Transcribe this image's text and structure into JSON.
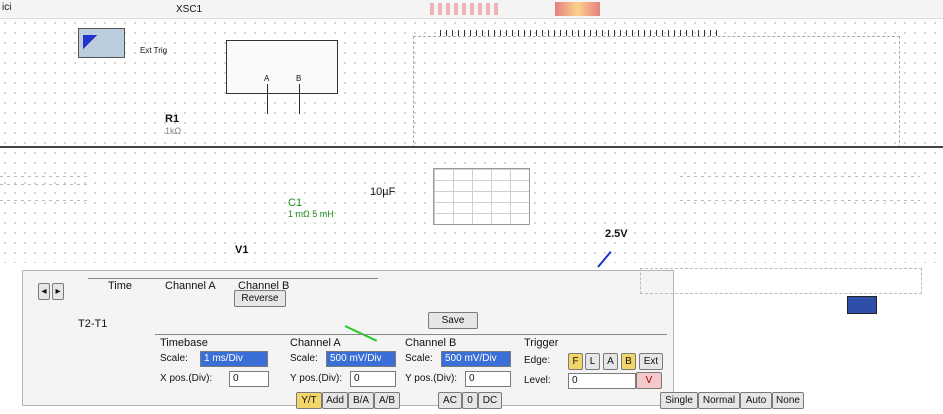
{
  "top_strip": {
    "left_label": "ici",
    "tab_a": "XSC1"
  },
  "schematic": {
    "ext_trig_label": "Ext Trig",
    "probe_a": "A",
    "probe_b": "B",
    "resistor": {
      "name": "R1",
      "value": "1kΩ"
    },
    "capacitor": {
      "name": "C1",
      "value": "10µF"
    },
    "c1_sub": "C1",
    "c1_sub2": "1 mΩ 5 mH",
    "source": {
      "name": "V1",
      "value": "2.5V"
    }
  },
  "scope_window": {
    "columns": {
      "time": "Time",
      "channel_a": "Channel A",
      "channel_b": "Channel B"
    },
    "t2_label": "T2-T1",
    "reverse_button": "Reverse",
    "save_button": "Save",
    "timebase": {
      "title": "Timebase",
      "scale_label": "Scale:",
      "scale_value": "1 ms/Div",
      "xpos_label": "X pos.(Div):",
      "xpos_value": "0"
    },
    "channel_a": {
      "title": "Channel A",
      "scale_label": "Scale:",
      "scale_value": "500 mV/Div",
      "ypos_label": "Y pos.(Div):",
      "ypos_value": "0"
    },
    "channel_b": {
      "title": "Channel B",
      "scale_label": "Scale:",
      "scale_value": "500 mV/Div",
      "ypos_label": "Y pos.(Div):",
      "ypos_value": "0"
    },
    "trigger": {
      "title": "Trigger",
      "edge_label": "Edge:",
      "level_label": "Level:",
      "level_value": "0",
      "level_unit": "V",
      "edge_buttons": [
        "F",
        "L",
        "A",
        "B",
        "Ext"
      ]
    },
    "bottom_buttons_a": [
      "Y/T",
      "Add",
      "B/A",
      "A/B"
    ],
    "bottom_buttons_b": [
      "AC",
      "0",
      "DC"
    ],
    "mode_buttons": [
      "Single",
      "Normal",
      "Auto",
      "None"
    ]
  },
  "colors": {
    "accent": "#3a6fd8",
    "selected_field": "#3a6fd8",
    "trigger_on": "#f3d66a",
    "arrow": "#2233cc"
  }
}
